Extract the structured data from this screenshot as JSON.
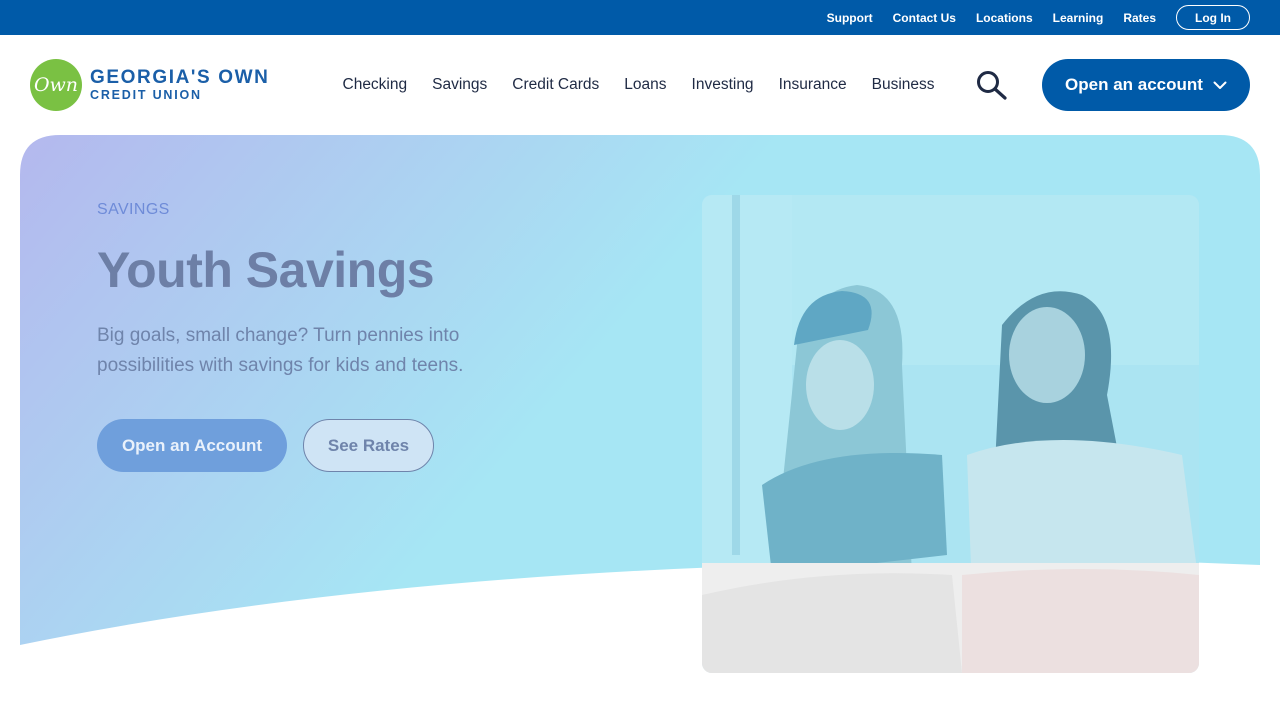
{
  "utility_bar": {
    "links": [
      "Support",
      "Contact Us",
      "Locations",
      "Learning",
      "Rates"
    ],
    "login_label": "Log In"
  },
  "logo": {
    "badge_text": "Own",
    "line1": "GEORGIA'S OWN",
    "line2": "CREDIT UNION"
  },
  "nav": {
    "items": [
      "Checking",
      "Savings",
      "Credit Cards",
      "Loans",
      "Investing",
      "Insurance",
      "Business"
    ],
    "search_icon": "search-icon",
    "cta_label": "Open an account",
    "cta_icon": "chevron-down-icon"
  },
  "hero": {
    "eyebrow": "SAVINGS",
    "title": "Youth Savings",
    "subtitle": "Big goals, small change? Turn pennies into possibilities with savings for kids and teens.",
    "primary_button": "Open an Account",
    "secondary_button": "See Rates"
  },
  "colors": {
    "brand_blue": "#005aa8",
    "logo_green": "#7ac143",
    "hero_gradient_start": "#b4b8ee",
    "hero_gradient_end": "#a6e6f4"
  }
}
